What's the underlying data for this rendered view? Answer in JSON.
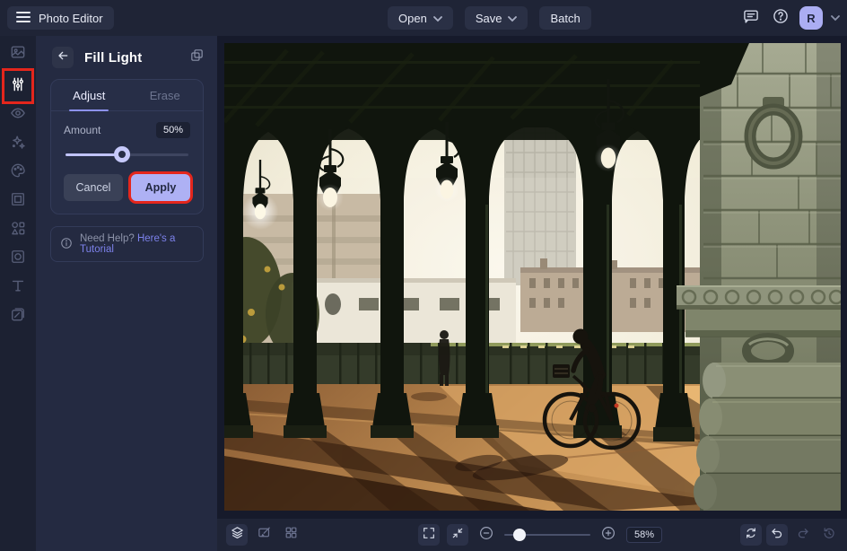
{
  "topbar": {
    "app_label": "Photo Editor",
    "open_label": "Open",
    "save_label": "Save",
    "batch_label": "Batch",
    "avatar_initial": "R"
  },
  "sidebar": {
    "items": [
      {
        "name": "image-manager",
        "icon": "image-icon",
        "active": false
      },
      {
        "name": "edit",
        "icon": "sliders-icon",
        "active": true,
        "highlighted_red": true
      },
      {
        "name": "touch-up",
        "icon": "eye-icon",
        "active": false
      },
      {
        "name": "effects",
        "icon": "sparkles-icon",
        "active": false
      },
      {
        "name": "artsy",
        "icon": "palette-icon",
        "active": false
      },
      {
        "name": "frames",
        "icon": "frame-icon",
        "active": false
      },
      {
        "name": "graphics",
        "icon": "shapes-icon",
        "active": false
      },
      {
        "name": "overlays",
        "icon": "overlay-icon",
        "active": false
      },
      {
        "name": "text",
        "icon": "text-icon",
        "active": false
      },
      {
        "name": "textures",
        "icon": "texture-icon",
        "active": false
      }
    ]
  },
  "panel": {
    "title": "Fill Light",
    "tabs": [
      {
        "label": "Adjust",
        "active": true
      },
      {
        "label": "Erase",
        "active": false
      }
    ],
    "amount_label": "Amount",
    "amount_value": "50%",
    "amount_percent": 50,
    "cancel_label": "Cancel",
    "apply_label": "Apply",
    "help_prefix": "Need Help?",
    "help_link_label": "Here's a Tutorial"
  },
  "bottombar": {
    "zoom_value": "58%",
    "zoom_percent": 58
  },
  "icons": {
    "topbar": [
      "menu-icon",
      "chevron-down-icon",
      "chat-icon",
      "help-icon"
    ],
    "panel": [
      "back-arrow-icon",
      "copy-settings-icon",
      "info-icon"
    ],
    "bottombar": [
      "layers-icon",
      "draw-icon",
      "grid-icon",
      "fullscreen-icon",
      "fit-screen-icon",
      "zoom-out-icon",
      "zoom-in-icon",
      "sync-icon",
      "undo-icon",
      "redo-icon",
      "history-icon"
    ]
  },
  "colors": {
    "accent_lavender": "#aeb1f4",
    "highlight_red": "#e4261c",
    "link_purple": "#7c81ea",
    "topbar_bg": "#1f2436",
    "panel_bg": "#242a41",
    "canvas_bg": "#161a2b",
    "avatar_bg": "#abadf2"
  },
  "photo_state": {
    "tool_applied": "Fill Light",
    "canvas_zoom": "58%"
  }
}
